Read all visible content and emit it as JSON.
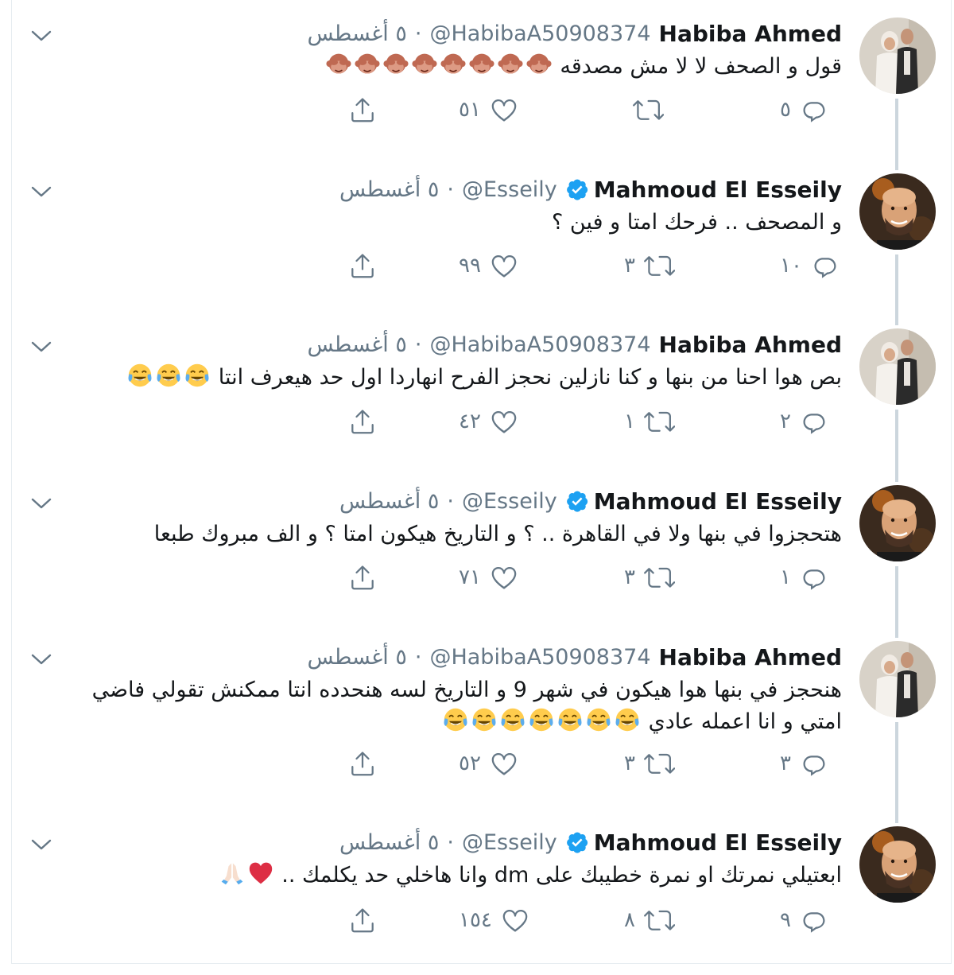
{
  "colors": {
    "secondary_text": "#657786",
    "primary_text": "#14171a",
    "verified_blue": "#1da1f2",
    "thread_line": "#ccd6dd"
  },
  "tweets": [
    {
      "name": "Habiba Ahmed",
      "handle": "@HabibaA50908374",
      "separator": "·",
      "date": "٥ أغسطس",
      "verified": false,
      "avatar": "avatar-couple",
      "text": "قول و الصحف لا لا مش مصدقه",
      "emojis": [
        "see-no-evil-monkey-emoji",
        "see-no-evil-monkey-emoji",
        "see-no-evil-monkey-emoji",
        "see-no-evil-monkey-emoji",
        "see-no-evil-monkey-emoji",
        "see-no-evil-monkey-emoji",
        "see-no-evil-monkey-emoji",
        "see-no-evil-monkey-emoji"
      ],
      "replies": "٥",
      "retweets": "",
      "likes": "٥١"
    },
    {
      "name": "Mahmoud El Esseily",
      "handle": "@Esseily",
      "separator": "·",
      "date": "٥ أغسطس",
      "verified": true,
      "avatar": "avatar-man",
      "text": "و المصحف .. فرحك امتا و فين ؟",
      "emojis": [],
      "replies": "١٠",
      "retweets": "٣",
      "likes": "٩٩"
    },
    {
      "name": "Habiba Ahmed",
      "handle": "@HabibaA50908374",
      "separator": "·",
      "date": "٥ أغسطس",
      "verified": false,
      "avatar": "avatar-couple",
      "text": "بص هوا احنا من بنها و كنا نازلين نحجز الفرح انهاردا اول حد هيعرف انتا",
      "emojis": [
        "tears-of-joy-emoji",
        "tears-of-joy-emoji",
        "tears-of-joy-emoji"
      ],
      "replies": "٢",
      "retweets": "١",
      "likes": "٤٢"
    },
    {
      "name": "Mahmoud El Esseily",
      "handle": "@Esseily",
      "separator": "·",
      "date": "٥ أغسطس",
      "verified": true,
      "avatar": "avatar-man",
      "text": "هتحجزوا في بنها ولا في القاهرة .. ؟ و التاريخ هيكون امتا ؟ و الف مبروك طبعا",
      "emojis": [],
      "replies": "١",
      "retweets": "٣",
      "likes": "٧١"
    },
    {
      "name": "Habiba Ahmed",
      "handle": "@HabibaA50908374",
      "separator": "·",
      "date": "٥ أغسطس",
      "verified": false,
      "avatar": "avatar-couple",
      "text": "هنحجز في بنها هوا هيكون في شهر 9 و التاريخ لسه هنحدده انتا ممكنش تقولي فاضي امتي و انا اعمله عادي",
      "emojis": [
        "tears-of-joy-emoji",
        "tears-of-joy-emoji",
        "tears-of-joy-emoji",
        "tears-of-joy-emoji",
        "tears-of-joy-emoji",
        "tears-of-joy-emoji",
        "tears-of-joy-emoji"
      ],
      "replies": "٣",
      "retweets": "٣",
      "likes": "٥٢"
    },
    {
      "name": "Mahmoud El Esseily",
      "handle": "@Esseily",
      "separator": "·",
      "date": "٥ أغسطس",
      "verified": true,
      "avatar": "avatar-man",
      "text": "ابعتيلي نمرتك او نمرة خطيبك على dm وانا هاخلي حد يكلمك ..",
      "emojis": [
        "red-heart-emoji",
        "folded-hands-emoji"
      ],
      "replies": "٩",
      "retweets": "٨",
      "likes": "١٥٤"
    }
  ]
}
